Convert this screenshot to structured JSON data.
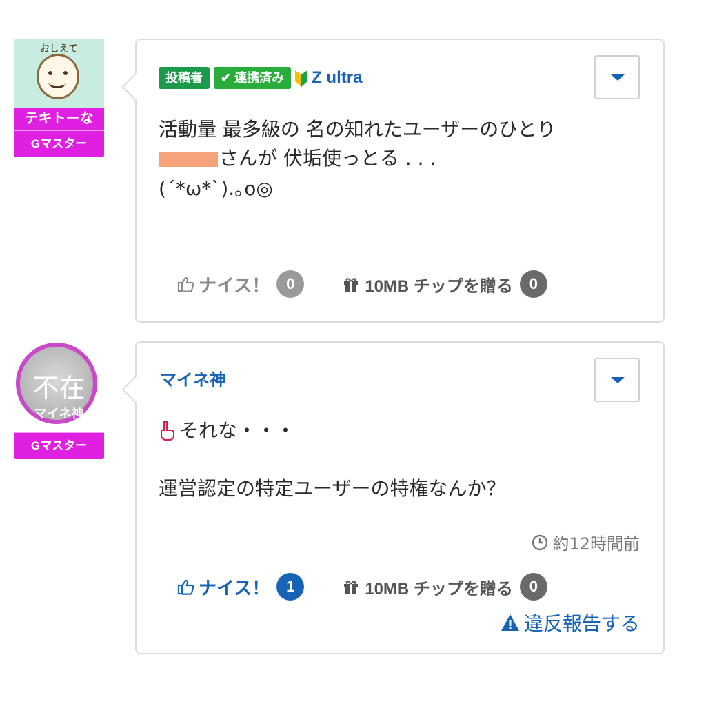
{
  "posts": [
    {
      "avatar_caption": "おしえて",
      "avatar_nick": "テキトーな",
      "rank": "Gマスター",
      "badge_poster": "投稿者",
      "badge_linked": "連携済み",
      "device": "Z ultra",
      "body_lines": [
        "活動量 最多級の 名の知れたユーザーのひとり",
        "さんが 伏垢使っとる . . .",
        "(´*ω*`).｡o◎"
      ],
      "nice_label": "ナイス！",
      "nice_count": "0",
      "tip_label": "10MB チップを贈る",
      "tip_count": "0"
    },
    {
      "avatar_absent": "不在",
      "avatar_subname": "マイネ神",
      "rank": "Gマスター",
      "username": "マイネ神",
      "body_lines": [
        "それな・・・",
        "運営認定の特定ユーザーの特権なんか？"
      ],
      "timestamp": "約12時間前",
      "nice_label": "ナイス！",
      "nice_count": "1",
      "tip_label": "10MB チップを贈る",
      "tip_count": "0",
      "report_label": "違反報告する"
    }
  ],
  "icons": {
    "menu": "chevron-down-icon",
    "thumb": "thumbs-up-icon",
    "gift": "gift-icon",
    "clock": "clock-icon",
    "warning": "warning-icon",
    "leaf": "beginner-mark-icon",
    "pointing": "pointing-hand-icon"
  },
  "colors": {
    "accent_blue": "#1763b6",
    "rank_magenta": "#e020e0",
    "badge_green": "#1a9a4a"
  }
}
